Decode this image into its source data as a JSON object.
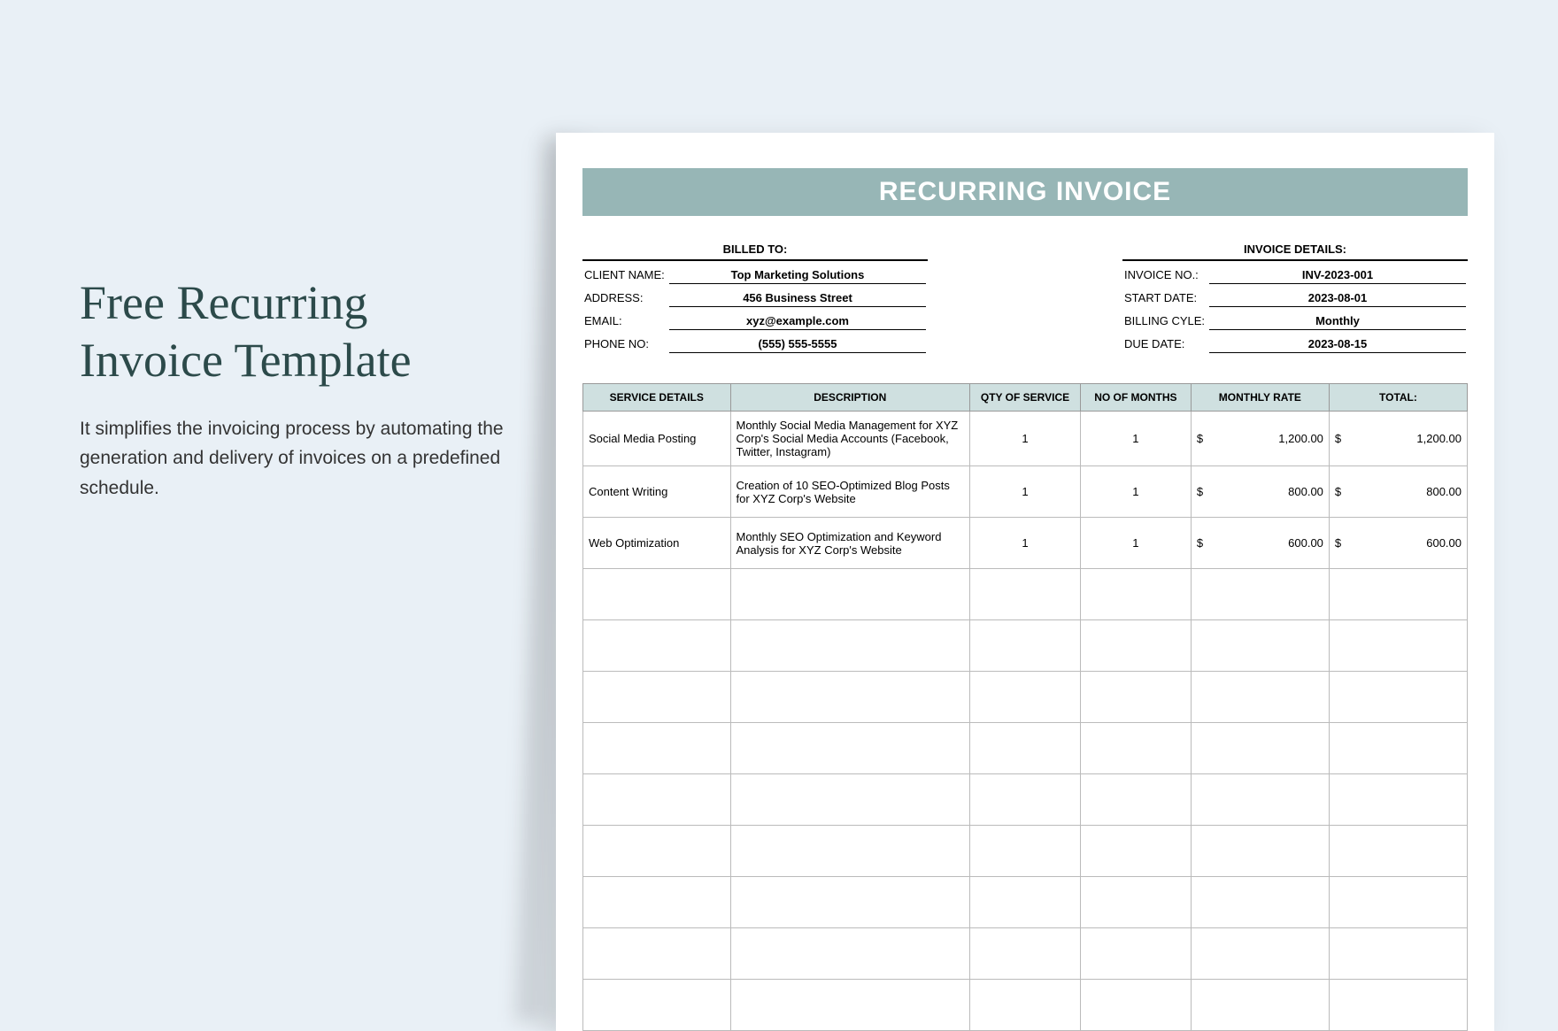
{
  "left": {
    "title": "Free Recurring Invoice Template",
    "subtitle": "It simplifies the invoicing process by automating the generation and delivery of invoices on a predefined schedule."
  },
  "invoice": {
    "header": "RECURRING INVOICE",
    "billed_to_heading": "BILLED TO:",
    "invoice_details_heading": "INVOICE DETAILS:",
    "billed": {
      "client_label": "CLIENT NAME:",
      "client_value": "Top Marketing Solutions",
      "address_label": "ADDRESS:",
      "address_value": "456 Business Street",
      "email_label": "EMAIL:",
      "email_value": "xyz@example.com",
      "phone_label": "PHONE NO:",
      "phone_value": "(555) 555-5555"
    },
    "details": {
      "invoice_no_label": "INVOICE NO.:",
      "invoice_no_value": "INV-2023-001",
      "start_date_label": "START DATE:",
      "start_date_value": "2023-08-01",
      "billing_cycle_label": "BILLING CYLE:",
      "billing_cycle_value": "Monthly",
      "due_date_label": "DUE DATE:",
      "due_date_value": "2023-08-15"
    },
    "columns": {
      "service": "SERVICE DETAILS",
      "description": "DESCRIPTION",
      "qty": "QTY OF SERVICE",
      "months": "NO OF MONTHS",
      "rate": "MONTHLY RATE",
      "total": "TOTAL:"
    },
    "rows": [
      {
        "service": "Social Media Posting",
        "description": "Monthly Social Media Management for XYZ Corp's Social Media Accounts (Facebook, Twitter, Instagram)",
        "qty": "1",
        "months": "1",
        "rate_sym": "$",
        "rate": "1,200.00",
        "total_sym": "$",
        "total": "1,200.00"
      },
      {
        "service": "Content Writing",
        "description": "Creation of 10 SEO-Optimized Blog Posts for XYZ Corp's Website",
        "qty": "1",
        "months": "1",
        "rate_sym": "$",
        "rate": "800.00",
        "total_sym": "$",
        "total": "800.00"
      },
      {
        "service": "Web Optimization",
        "description": "Monthly SEO Optimization and Keyword Analysis for XYZ Corp's Website",
        "qty": "1",
        "months": "1",
        "rate_sym": "$",
        "rate": "600.00",
        "total_sym": "$",
        "total": "600.00"
      }
    ],
    "empty_rows": 9
  }
}
